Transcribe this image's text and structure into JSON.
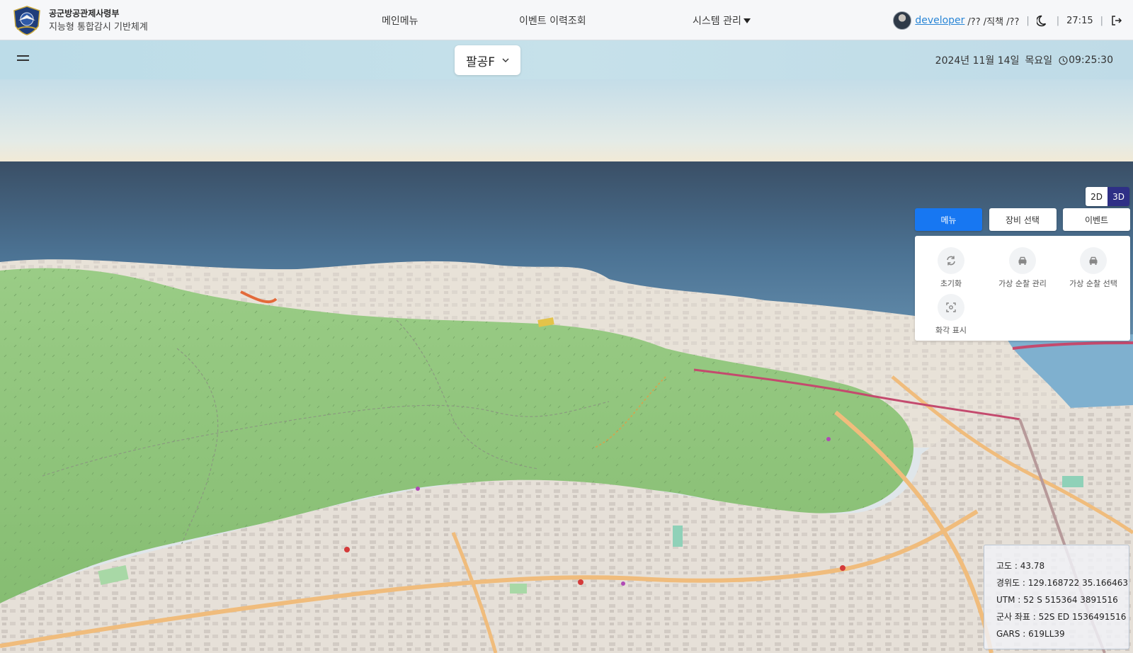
{
  "header": {
    "org": "공군방공관제사령부",
    "system": "지능형 통합감시 기반체계",
    "nav": [
      "메인메뉴",
      "이벤트 이력조회",
      "시스템 관리"
    ],
    "user": {
      "name": "developer",
      "info": "/?? /직책 /??",
      "timer": "27:15"
    },
    "icons": [
      "dark-mode-moon-icon",
      "logout-icon"
    ]
  },
  "toolbar": {
    "site": "팔공F",
    "date": "2024년 11월 14일",
    "day": "목요일",
    "time": "09:25:30"
  },
  "panel": {
    "view_modes": [
      "2D",
      "3D"
    ],
    "active_view": "3D",
    "tabs": [
      "메뉴",
      "장비 선택",
      "이벤트"
    ],
    "active_tab": "메뉴",
    "tools": [
      {
        "label": "초기화",
        "icon": "refresh-icon"
      },
      {
        "label": "가상 순찰 관리",
        "icon": "patrol-car-icon"
      },
      {
        "label": "가상 순찰 선택",
        "icon": "patrol-car-icon"
      },
      {
        "label": "화각 표시",
        "icon": "view-angle-icon"
      }
    ]
  },
  "coordinates": {
    "altitude": "고도 : 43.78",
    "latlon": "경위도 : 129.168722 35.166463",
    "utm": "UTM : 52 S 515364 3891516",
    "military": "군사 좌표 : 52S ED 1536491516",
    "gars": "GARS : 619LL39"
  },
  "colors": {
    "accent": "#1777f2",
    "view_active": "#2e2f86",
    "link": "#2a86d6",
    "forest": "#8fc47d",
    "sea": "#6a9fc0",
    "road": "#f2c085"
  }
}
